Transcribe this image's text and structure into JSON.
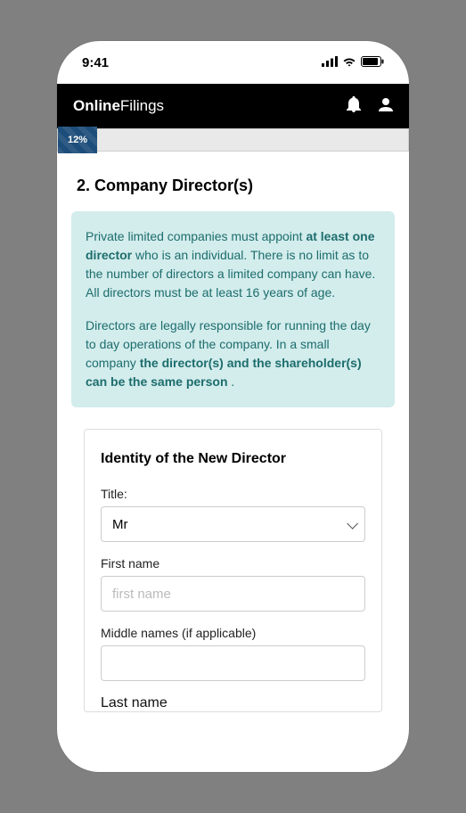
{
  "status": {
    "time": "9:41"
  },
  "header": {
    "brand_bold": "Online",
    "brand_light": "Filings"
  },
  "progress": {
    "percent_label": "12%"
  },
  "section": {
    "title": "2. Company Director(s)"
  },
  "info": {
    "p1_a": "Private limited companies must appoint ",
    "p1_b": "at least one director",
    "p1_c": " who is an individual. There is no limit as to the number of directors a limited company can have. All directors must be at least 16 years of age.",
    "p2_a": "Directors are legally responsible for running the day to day operations of the company. In a small company ",
    "p2_b": "the director(s) and the shareholder(s) can be the same person",
    "p2_c": " ."
  },
  "form": {
    "card_title": "Identity of the New Director",
    "title_label": "Title:",
    "title_value": "Mr",
    "first_name_label": "First name",
    "first_name_placeholder": "first name",
    "middle_names_label": "Middle names (if applicable)",
    "last_name_label": "Last name"
  }
}
